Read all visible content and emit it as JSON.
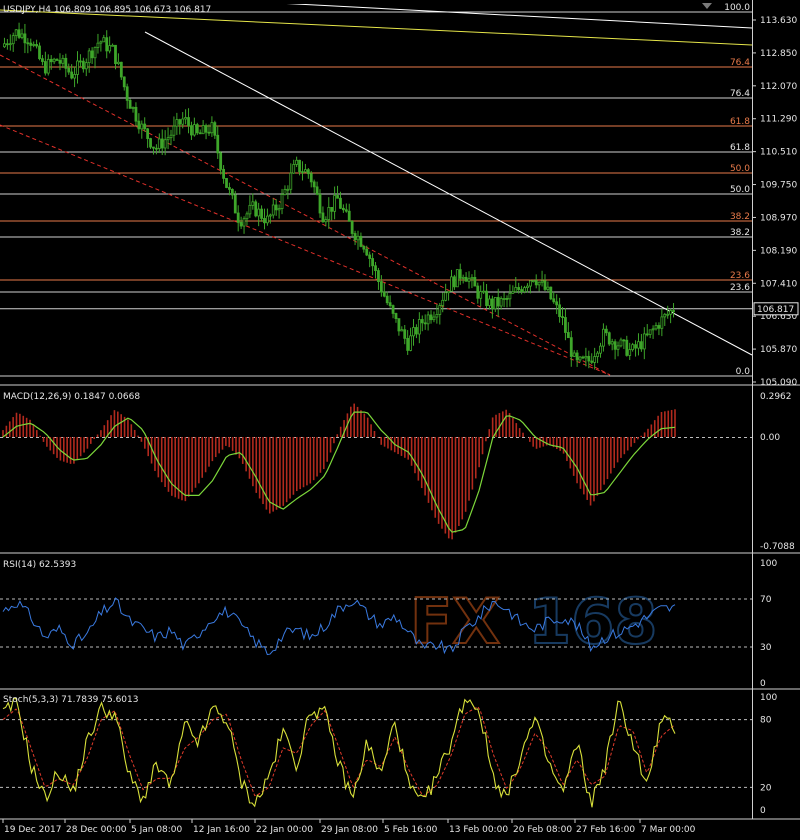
{
  "colors": {
    "background": "#000000",
    "candle": "#3ea62a",
    "fib_a": "#e87a4a",
    "fib_b": "#cfcfcf",
    "trend_white": "#ffffff",
    "trend_yellow": "#e6e64a",
    "dashed_red": "#e0302a",
    "macd_hist": "#b22a1e",
    "macd_signal": "#7cd73a",
    "rsi_line": "#3a7ae0",
    "stoch_main": "#d8e03a",
    "stoch_signal": "#e03a2a",
    "watermark_fx": "#d05a1a",
    "watermark_168": "#2a6ab0"
  },
  "chart_data": [
    {
      "type": "candlestick",
      "title": "USDJPY,H4  106.809 106.895 106.673 106.817",
      "ylim": [
        105.09,
        113.9
      ],
      "price_ticks": [
        "113.630",
        "112.850",
        "112.070",
        "111.290",
        "110.510",
        "109.750",
        "108.970",
        "108.190",
        "107.410",
        "106.630",
        "105.870",
        "105.090"
      ],
      "current_price": "106.817",
      "fib_a_labels": [
        "76.4",
        "61.8",
        "50.0",
        "38.2",
        "23.6"
      ],
      "fib_b_labels": [
        "100.0",
        "76.4",
        "61.8",
        "50.0",
        "38.2",
        "23.6",
        "0.0"
      ],
      "close_path": [
        [
          "19 Dec 2017",
          113.0
        ],
        [
          "22 Dec",
          113.35
        ],
        [
          "25 Dec",
          113.2
        ],
        [
          "27 Dec",
          112.5
        ],
        [
          "28 Dec",
          112.7
        ],
        [
          "1 Jan",
          112.35
        ],
        [
          "3 Jan",
          112.7
        ],
        [
          "5 Jan",
          113.15
        ],
        [
          "8 Jan",
          112.9
        ],
        [
          "9 Jan",
          111.8
        ],
        [
          "11 Jan",
          111.1
        ],
        [
          "13 Jan",
          110.6
        ],
        [
          "16 Jan",
          110.9
        ],
        [
          "17 Jan",
          111.3
        ],
        [
          "19 Jan",
          110.9
        ],
        [
          "20 Jan",
          111.1
        ],
        [
          "22 Jan",
          109.8
        ],
        [
          "24 Jan",
          108.9
        ],
        [
          "26 Jan",
          109.2
        ],
        [
          "28 Jan",
          108.9
        ],
        [
          "30 Jan",
          109.4
        ],
        [
          "1 Feb",
          110.2
        ],
        [
          "2 Feb",
          110.0
        ],
        [
          "4 Feb",
          109.0
        ],
        [
          "6 Feb",
          109.4
        ],
        [
          "8 Feb",
          108.7
        ],
        [
          "10 Feb",
          108.3
        ],
        [
          "12 Feb",
          107.4
        ],
        [
          "14 Feb",
          106.6
        ],
        [
          "15 Feb",
          106.0
        ],
        [
          "17 Feb",
          106.5
        ],
        [
          "19 Feb",
          106.8
        ],
        [
          "20 Feb",
          107.4
        ],
        [
          "21 Feb",
          107.7
        ],
        [
          "22 Feb",
          107.2
        ],
        [
          "23 Feb",
          106.9
        ],
        [
          "24 Feb",
          107.0
        ],
        [
          "26 Feb",
          107.3
        ],
        [
          "27 Feb",
          107.6
        ],
        [
          "28 Feb",
          107.2
        ],
        [
          "1 Mar",
          106.6
        ],
        [
          "2 Mar",
          105.5
        ],
        [
          "3 Mar",
          105.6
        ],
        [
          "5 Mar",
          106.2
        ],
        [
          "6 Mar",
          106.0
        ],
        [
          "7 Mar",
          105.8
        ],
        [
          "8 Mar",
          106.1
        ],
        [
          "9 Mar",
          106.5
        ],
        [
          "10 Mar",
          106.82
        ]
      ]
    },
    {
      "type": "macd",
      "title": "MACD(12,26,9) 0.1847 0.0668",
      "ylim": [
        -0.7088,
        0.2962
      ],
      "ticks": [
        "0.2962",
        "0.00",
        "-0.7088"
      ],
      "histogram": [
        0.05,
        0.18,
        0.12,
        -0.05,
        -0.15,
        -0.18,
        -0.08,
        0.05,
        0.2,
        0.12,
        -0.05,
        -0.25,
        -0.38,
        -0.42,
        -0.3,
        -0.15,
        -0.05,
        -0.15,
        -0.35,
        -0.5,
        -0.45,
        -0.35,
        -0.3,
        -0.2,
        0.05,
        0.25,
        0.15,
        -0.05,
        -0.1,
        -0.15,
        -0.35,
        -0.55,
        -0.68,
        -0.5,
        -0.2,
        0.15,
        0.2,
        0.05,
        -0.08,
        -0.05,
        -0.1,
        -0.3,
        -0.45,
        -0.3,
        -0.15,
        -0.05,
        0.05,
        0.18,
        0.2
      ],
      "signal": [
        0.0,
        0.08,
        0.1,
        0.03,
        -0.08,
        -0.15,
        -0.14,
        -0.05,
        0.08,
        0.14,
        0.05,
        -0.15,
        -0.3,
        -0.38,
        -0.38,
        -0.28,
        -0.12,
        -0.1,
        -0.25,
        -0.42,
        -0.47,
        -0.4,
        -0.34,
        -0.25,
        -0.05,
        0.18,
        0.18,
        0.05,
        -0.05,
        -0.1,
        -0.25,
        -0.45,
        -0.62,
        -0.6,
        -0.35,
        0.0,
        0.16,
        0.12,
        0.0,
        -0.05,
        -0.07,
        -0.2,
        -0.38,
        -0.36,
        -0.24,
        -0.12,
        -0.02,
        0.06,
        0.07
      ]
    },
    {
      "type": "rsi",
      "title": "RSI(14) 62.5393",
      "ylim": [
        0,
        100
      ],
      "ticks": [
        "100",
        "70",
        "30",
        "0"
      ],
      "levels": [
        70,
        30
      ],
      "values": [
        60,
        68,
        55,
        38,
        45,
        33,
        40,
        58,
        68,
        52,
        45,
        38,
        44,
        30,
        42,
        55,
        60,
        48,
        35,
        25,
        40,
        45,
        38,
        48,
        62,
        70,
        58,
        48,
        56,
        42,
        28,
        32,
        26,
        45,
        55,
        68,
        62,
        50,
        45,
        52,
        55,
        48,
        30,
        38,
        42,
        48,
        55,
        62,
        62.5
      ]
    },
    {
      "type": "stochastic",
      "title": "Stoch(5,3,3) 71.7839 75.6013",
      "ylim": [
        0,
        100
      ],
      "ticks": [
        "100",
        "80",
        "20",
        "0"
      ],
      "levels": [
        80,
        20
      ],
      "main": [
        85,
        95,
        40,
        10,
        35,
        15,
        60,
        90,
        85,
        30,
        10,
        40,
        20,
        75,
        60,
        90,
        80,
        25,
        5,
        30,
        70,
        40,
        90,
        85,
        40,
        10,
        60,
        30,
        80,
        20,
        5,
        30,
        60,
        100,
        90,
        30,
        10,
        50,
        80,
        40,
        15,
        60,
        5,
        40,
        95,
        60,
        20,
        80,
        72
      ],
      "signal": [
        80,
        90,
        55,
        20,
        28,
        22,
        45,
        80,
        88,
        50,
        18,
        28,
        28,
        55,
        65,
        80,
        85,
        45,
        12,
        20,
        55,
        50,
        75,
        88,
        55,
        20,
        45,
        38,
        65,
        35,
        12,
        22,
        48,
        85,
        92,
        50,
        18,
        38,
        68,
        52,
        22,
        45,
        22,
        30,
        75,
        70,
        32,
        65,
        75.6
      ]
    }
  ],
  "x_axis": [
    "19 Dec 2017",
    "28 Dec 00:00",
    "5 Jan 08:00",
    "12 Jan 16:00",
    "22 Jan 00:00",
    "29 Jan 08:00",
    "5 Feb 16:00",
    "13 Feb 00:00",
    "20 Feb 08:00",
    "27 Feb 16:00",
    "7 Mar 00:00"
  ],
  "watermark": {
    "left": "FX",
    "right": "168"
  }
}
